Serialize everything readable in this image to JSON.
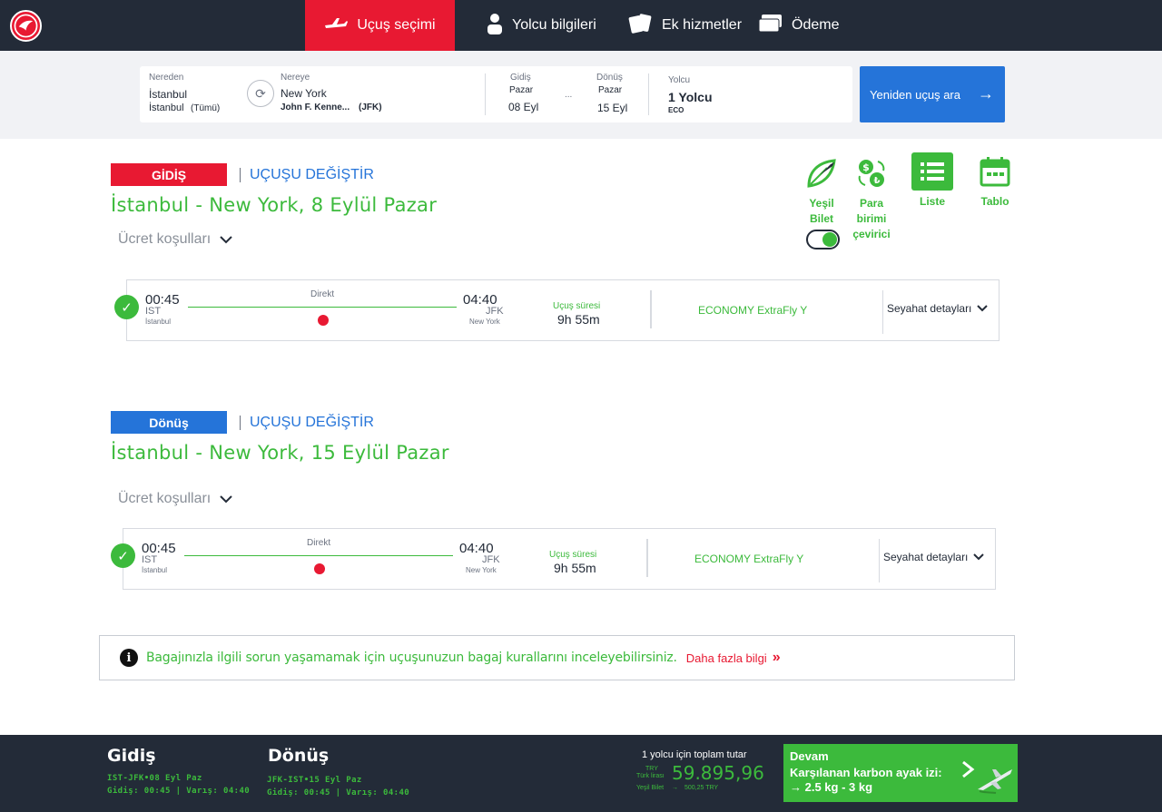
{
  "nav": {
    "steps": [
      {
        "label": "Uçuş seçimi",
        "active": true
      },
      {
        "label": "Yolcu bilgileri",
        "active": false
      },
      {
        "label": "Ek hizmetler",
        "active": false
      },
      {
        "label": "Ödeme",
        "active": false
      }
    ]
  },
  "search": {
    "from_label": "Nereden",
    "from_city": "İstanbul",
    "from_airport": "İstanbul",
    "from_airport_suffix": "(Tümü)",
    "to_label": "Nereye",
    "to_city": "New York",
    "to_airport": "John F. Kenne...",
    "to_airport_code": "(JFK)",
    "dep_label": "Gidiş",
    "dep_day": "Pazar",
    "dep_date": "08 Eyl",
    "ret_label": "Dönüş",
    "ret_day": "Pazar",
    "ret_date": "15 Eyl",
    "dots": "...",
    "pax_label": "Yolcu",
    "pax_value": "1 Yolcu",
    "cabin": "ECO",
    "research_button": "Yeniden uçuş ara"
  },
  "tools": {
    "green_ticket": [
      "Yeşil",
      "Bilet"
    ],
    "currency": [
      "Para",
      "birimi",
      "çevirici"
    ],
    "list": "Liste",
    "table": "Tablo",
    "green_ticket_on": true
  },
  "legs": [
    {
      "badge": "GİDİŞ",
      "change_link": "UÇUŞU DEĞİŞTİR",
      "title": "İstanbul - New York, 8 Eylül Pazar",
      "fare_conditions": "Ücret koşulları",
      "flight": {
        "dep_time": "00:45",
        "dep_code": "IST",
        "dep_city": "İstanbul",
        "arr_time": "04:40",
        "arr_code": "JFK",
        "arr_city": "New York",
        "stops": "Direkt",
        "duration_label": "Uçuş süresi",
        "duration": "9h 55m",
        "fare": "ECONOMY ExtraFly Y",
        "details": "Seyahat detayları"
      }
    },
    {
      "badge": "Dönüş",
      "change_link": "UÇUŞU DEĞİŞTİR",
      "title": "İstanbul - New York, 15 Eylül Pazar",
      "fare_conditions": "Ücret koşulları",
      "flight": {
        "dep_time": "00:45",
        "dep_code": "IST",
        "dep_city": "İstanbul",
        "arr_time": "04:40",
        "arr_code": "JFK",
        "arr_city": "New York",
        "stops": "Direkt",
        "duration_label": "Uçuş süresi",
        "duration": "9h 55m",
        "fare": "ECONOMY ExtraFly Y",
        "details": "Seyahat detayları"
      }
    }
  ],
  "info": {
    "icon": "i",
    "text": "Bagajınızla ilgili sorun yaşamamak için uçuşunuzun bagaj kurallarını inceleyebilirsiniz.",
    "link": "Daha fazla bilgi",
    "arrows": "»"
  },
  "footer": {
    "out_title": "Gidiş",
    "out_route": "IST-JFK•08 Eyl Paz",
    "out_times": "Gidiş: 00:45 | Varış: 04:40",
    "ret_title": "Dönüş",
    "ret_route": "JFK-IST•15 Eyl Paz",
    "ret_times": "Gidiş: 00:45 | Varış: 04:40",
    "total_label": "1 yolcu için toplam tutar",
    "currency_code": "TRY",
    "currency_name": "Türk lirası",
    "price": "59.895,96",
    "green_ticket_label": "Yeşil Bilet",
    "green_ticket_value": "500,25 TRY",
    "continue": "Devam",
    "carbon_label": "Karşılanan karbon ayak izi:",
    "carbon_value": "2.5 kg - 3 kg"
  },
  "colors": {
    "brand_red": "#e81932",
    "navy": "#232b38",
    "green": "#3cba3c",
    "blue": "#2574d9"
  }
}
